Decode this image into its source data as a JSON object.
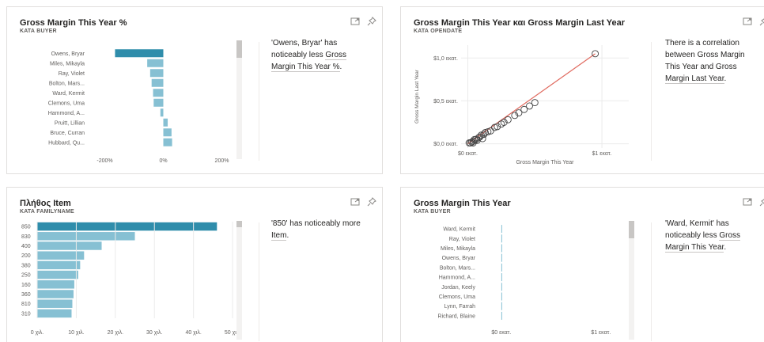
{
  "colors": {
    "bar_primary": "#2f8dab",
    "bar_secondary": "#86c0d3",
    "trend_line": "#e06a5f",
    "point": "#444444"
  },
  "card1": {
    "title": "Gross Margin This Year %",
    "subtitle": "ΚΑΤΑ BUYER",
    "icons": [
      "expand-icon",
      "pin-icon"
    ],
    "insight": [
      "'Owens, Bryar' has",
      "noticeably less ",
      "Gross",
      "Margin This Year %",
      "."
    ],
    "chart_data": {
      "type": "bar",
      "orientation": "horizontal",
      "categories": [
        "Owens, Bryar",
        "Miles, Mikayla",
        "Ray, Violet",
        "Bolton, Mars...",
        "Ward, Kermit",
        "Clemons, Uma",
        "Hammond, A...",
        "Pruitt, Lillian",
        "Bruce, Curran",
        "Hubbard, Qu..."
      ],
      "values": [
        -165,
        -55,
        -45,
        -40,
        -35,
        -33,
        -10,
        15,
        28,
        30
      ],
      "units": "%",
      "xlim": [
        -250,
        250
      ],
      "x_ticks": [
        "-200%",
        "0%",
        "200%"
      ],
      "x_tick_values": [
        -200,
        0,
        200
      ]
    }
  },
  "card2": {
    "title": "Gross Margin This Year και Gross Margin Last Year",
    "subtitle": "ΚΑΤΑ OPENDATE",
    "icons": [
      "expand-icon",
      "pin-icon"
    ],
    "insight": [
      "There is a correlation",
      "between Gross Margin",
      "This Year and Gross",
      "Margin Last Year",
      "."
    ],
    "chart_data": {
      "type": "scatter",
      "xlabel": "Gross Margin This Year",
      "ylabel": "Gross Margin Last Year",
      "x_ticks": [
        "$0 εκατ.",
        "$1 εκατ."
      ],
      "x_tick_values": [
        0,
        1
      ],
      "y_ticks": [
        "$0,0 εκατ.",
        "$0,5 εκατ.",
        "$1,0 εκατ."
      ],
      "y_tick_values": [
        0,
        0.5,
        1.0
      ],
      "xlim": [
        -0.05,
        1.2
      ],
      "ylim": [
        -0.05,
        1.15
      ],
      "points": [
        [
          0.01,
          0.01
        ],
        [
          0.02,
          0.01
        ],
        [
          0.03,
          0.02
        ],
        [
          0.04,
          0.03
        ],
        [
          0.05,
          0.05
        ],
        [
          0.06,
          0.05
        ],
        [
          0.08,
          0.07
        ],
        [
          0.09,
          0.08
        ],
        [
          0.1,
          0.1
        ],
        [
          0.12,
          0.11
        ],
        [
          0.13,
          0.13
        ],
        [
          0.15,
          0.14
        ],
        [
          0.17,
          0.15
        ],
        [
          0.2,
          0.19
        ],
        [
          0.22,
          0.2
        ],
        [
          0.25,
          0.23
        ],
        [
          0.27,
          0.25
        ],
        [
          0.3,
          0.28
        ],
        [
          0.35,
          0.33
        ],
        [
          0.38,
          0.36
        ],
        [
          0.42,
          0.4
        ],
        [
          0.46,
          0.44
        ],
        [
          0.5,
          0.48
        ],
        [
          0.04,
          0.01
        ],
        [
          0.07,
          0.04
        ],
        [
          0.11,
          0.06
        ],
        [
          0.95,
          1.05
        ]
      ],
      "trend": [
        [
          0,
          0
        ],
        [
          0.95,
          1.05
        ]
      ]
    }
  },
  "card3": {
    "title": "Πλήθος Item",
    "subtitle": "ΚΑΤΑ FAMILYNAME",
    "icons": [
      "expand-icon",
      "pin-icon"
    ],
    "insight": [
      "'850' has noticeably more",
      "Item",
      "."
    ],
    "chart_data": {
      "type": "bar",
      "orientation": "horizontal",
      "categories": [
        "850",
        "830",
        "400",
        "200",
        "380",
        "250",
        "160",
        "360",
        "810",
        "310"
      ],
      "values": [
        46000,
        25000,
        16500,
        12000,
        11000,
        10500,
        9500,
        9300,
        9000,
        8800
      ],
      "xlim": [
        0,
        51000
      ],
      "x_ticks": [
        "0 χιλ.",
        "10 χιλ.",
        "20 χιλ.",
        "30 χιλ.",
        "40 χιλ.",
        "50 χιλ."
      ],
      "x_tick_values": [
        0,
        10000,
        20000,
        30000,
        40000,
        50000
      ]
    }
  },
  "card4": {
    "title": "Gross Margin This Year",
    "subtitle": "ΚΑΤΑ BUYER",
    "icons": [
      "expand-icon",
      "pin-icon"
    ],
    "insight": [
      "'Ward, Kermit' has",
      "noticeably less ",
      "Gross",
      "Margin This Year",
      "."
    ],
    "chart_data": {
      "type": "bar",
      "orientation": "horizontal",
      "categories": [
        "Ward, Kermit",
        "Ray, Violet",
        "Miles, Mikayla",
        "Owens, Bryar",
        "Bolton, Mars...",
        "Hammond, A...",
        "Jordan, Keely",
        "Clemons, Uma",
        "Lynn, Farrah",
        "Richard, Blaine"
      ],
      "values": [
        0.002,
        0.002,
        0.002,
        0.002,
        0.002,
        0.002,
        0.002,
        0.002,
        0.002,
        0.002
      ],
      "xlim": [
        -0.15,
        1.2
      ],
      "x_ticks": [
        "$0 εκατ.",
        "$1 εκατ."
      ],
      "x_tick_values": [
        0,
        1
      ]
    }
  }
}
